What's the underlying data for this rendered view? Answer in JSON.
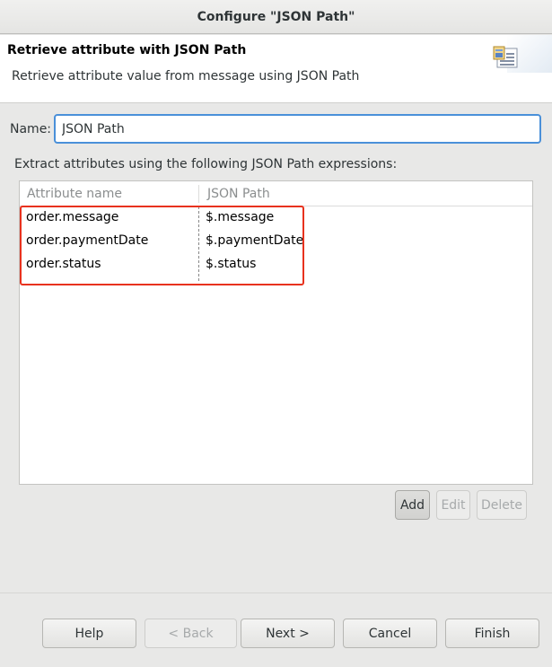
{
  "window": {
    "title": "Configure \"JSON Path\""
  },
  "header": {
    "title": "Retrieve attribute with JSON Path",
    "description": "Retrieve attribute value from message using JSON Path",
    "icon": "form-icon"
  },
  "name_field": {
    "label": "Name:",
    "value": "JSON Path"
  },
  "table": {
    "label": "Extract attributes using the following JSON Path expressions:",
    "columns": [
      "Attribute name",
      "JSON Path"
    ],
    "rows": [
      {
        "attribute": "order.message",
        "path": "$.message"
      },
      {
        "attribute": "order.paymentDate",
        "path": "$.paymentDate"
      },
      {
        "attribute": "order.status",
        "path": "$.status"
      }
    ]
  },
  "table_buttons": {
    "add": "Add",
    "edit": "Edit",
    "delete": "Delete"
  },
  "footer_buttons": {
    "help": "Help",
    "back": "< Back",
    "next": "Next >",
    "cancel": "Cancel",
    "finish": "Finish"
  },
  "colors": {
    "highlight": "#e8321e",
    "focus": "#4a90d9"
  }
}
